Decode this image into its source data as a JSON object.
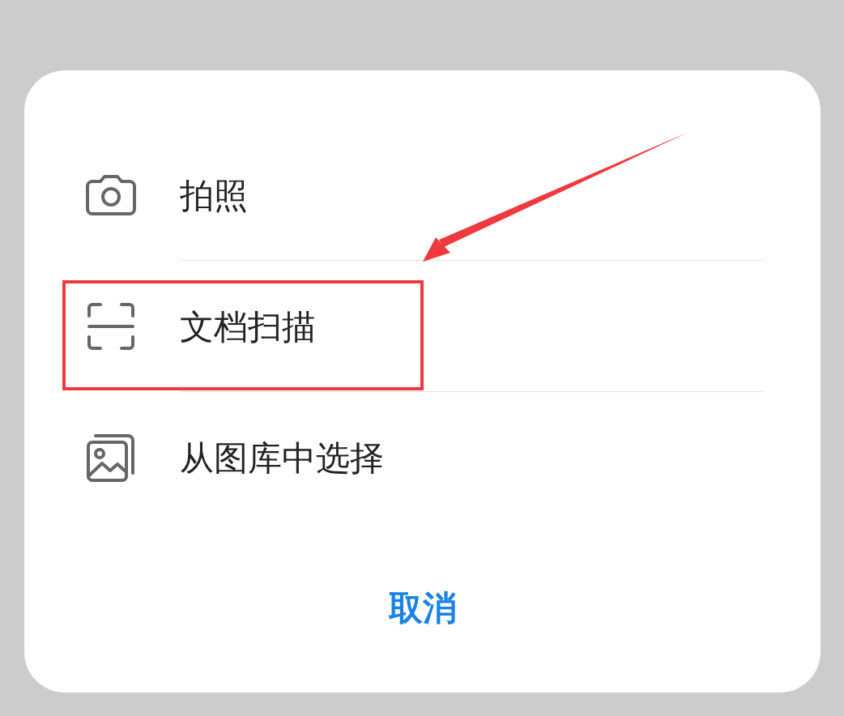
{
  "action_sheet": {
    "options": [
      {
        "kind": "camera",
        "label": "拍照",
        "highlighted": false
      },
      {
        "kind": "scan",
        "label": "文档扫描",
        "highlighted": true
      },
      {
        "kind": "gallery",
        "label": "从图库中选择",
        "highlighted": false
      }
    ],
    "cancel": "取消"
  }
}
